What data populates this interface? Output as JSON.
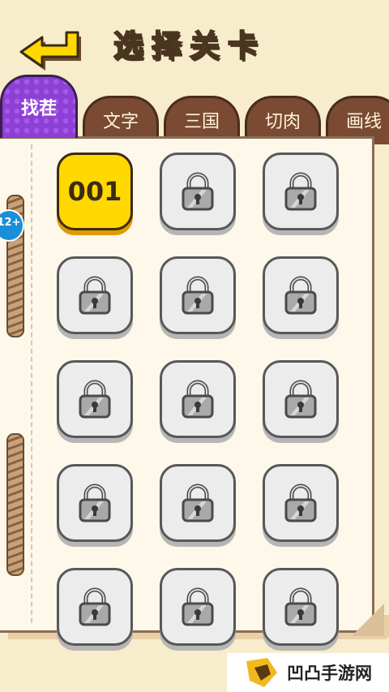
{
  "header": {
    "title": "选择关卡",
    "back_icon": "back-arrow-icon"
  },
  "colors": {
    "background": "#f7eccb",
    "active_tab": "#8e3fd6",
    "tab": "#7a4a33",
    "unlocked": "#ffd800",
    "locked": "#ececec"
  },
  "tabs": [
    {
      "label": "找茬",
      "active": true
    },
    {
      "label": "文字",
      "active": false
    },
    {
      "label": "三国",
      "active": false
    },
    {
      "label": "切肉",
      "active": false
    },
    {
      "label": "画线",
      "active": false
    }
  ],
  "age_badge": "12+",
  "levels": [
    {
      "label": "001",
      "locked": false
    },
    {
      "locked": true
    },
    {
      "locked": true
    },
    {
      "locked": true
    },
    {
      "locked": true
    },
    {
      "locked": true
    },
    {
      "locked": true
    },
    {
      "locked": true
    },
    {
      "locked": true
    },
    {
      "locked": true
    },
    {
      "locked": true
    },
    {
      "locked": true
    },
    {
      "locked": true
    },
    {
      "locked": true
    },
    {
      "locked": true
    }
  ],
  "watermark": {
    "text": "凹凸手游网"
  }
}
